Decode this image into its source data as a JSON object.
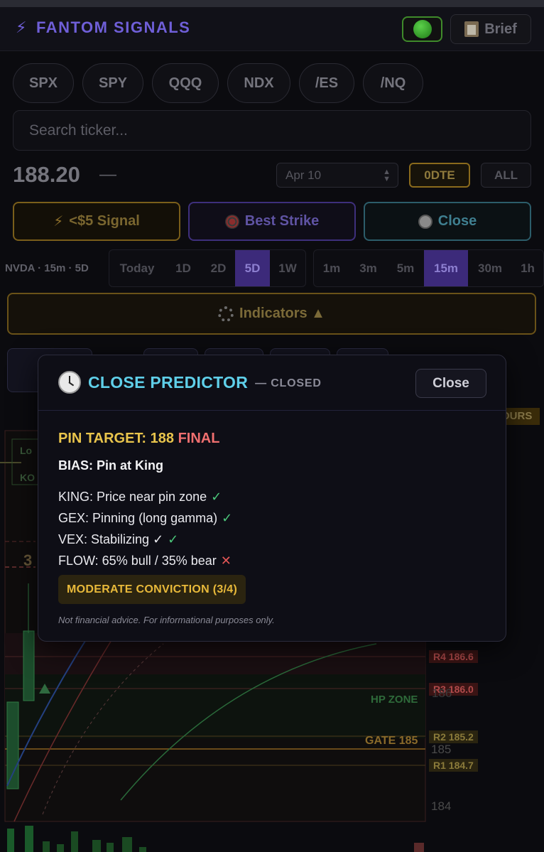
{
  "header": {
    "brand": "FANTOM SIGNALS",
    "brief_label": "Brief"
  },
  "tickers": [
    "SPX",
    "SPY",
    "QQQ",
    "NDX",
    "/ES",
    "/NQ"
  ],
  "search": {
    "placeholder": "Search ticker..."
  },
  "quote": {
    "price": "188.20",
    "change": "—",
    "expiry": "Apr 10",
    "odte_label": "0DTE",
    "all_label": "ALL"
  },
  "actions": {
    "signal": "<$5 Signal",
    "best_strike": "Best Strike",
    "close": "Close"
  },
  "timeframe": {
    "label": "NVDA · 15m · 5D",
    "ranges": [
      "Today",
      "1D",
      "2D",
      "5D",
      "1W"
    ],
    "active_range": "5D",
    "intervals": [
      "1m",
      "3m",
      "5m",
      "15m",
      "30m",
      "1h"
    ],
    "active_interval": "15m"
  },
  "indicators_label": "Indicators ▲",
  "chart_levels": {
    "r4": "R4 186.6",
    "r3": "R3 186.0",
    "r2": "R2 185.2",
    "r1": "R1 184.7",
    "hp_zone": "HP ZONE",
    "gate": "GATE 185",
    "axis": [
      "186",
      "185",
      "184"
    ],
    "hours_tag": "OURS"
  },
  "modal": {
    "title": "CLOSE PREDICTOR",
    "subtitle": "— CLOSED",
    "close_label": "Close",
    "pin_label": "PIN TARGET: 188",
    "pin_status": "FINAL",
    "bias": "BIAS: Pin at King",
    "checks": [
      {
        "text": "KING: Price near pin zone",
        "mark": "✓",
        "status": "ok"
      },
      {
        "text": "GEX: Pinning (long gamma)",
        "mark": "✓",
        "status": "ok"
      },
      {
        "text": "VEX: Stabilizing ✓",
        "mark": "✓",
        "status": "ok"
      },
      {
        "text": "FLOW: 65% bull / 35% bear",
        "mark": "✕",
        "status": "bad"
      }
    ],
    "conviction": "MODERATE CONVICTION (3/4)",
    "disclaimer": "Not financial advice. For informational purposes only."
  },
  "colors": {
    "accent": "#5fcfe9",
    "pin": "#e8c44c",
    "final": "#ef6f6f",
    "ok": "#4bc77a",
    "bad": "#e45656"
  }
}
